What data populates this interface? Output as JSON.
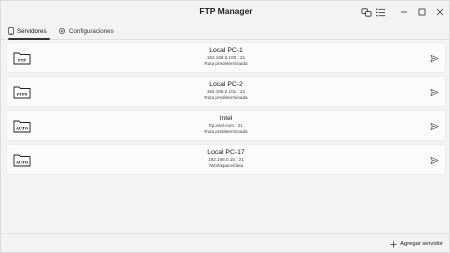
{
  "app": {
    "title": "FTP Manager"
  },
  "window_controls": {
    "minimize": "—",
    "maximize": "☐",
    "close": "✕"
  },
  "tabs": [
    {
      "label": "Servidores",
      "icon": "phone-icon",
      "active": true
    },
    {
      "label": "Configuraciones",
      "icon": "gear-icon",
      "active": false
    }
  ],
  "servers": [
    {
      "name": "Local PC-1",
      "host": "192.168.0.100 : 21",
      "path": "Ruta predeterminada",
      "badge": "FTP"
    },
    {
      "name": "Local PC-2",
      "host": "192.168.0.101 : 21",
      "path": "Ruta predeterminada",
      "badge": "FTPS"
    },
    {
      "name": "Intel",
      "host": "ftp.intel.com : 21",
      "path": "Ruta predeterminada",
      "badge": "AUTO"
    },
    {
      "name": "Local PC-17",
      "host": "192.168.0.15 : 21",
      "path": "/Workspace/data",
      "badge": "AUTO"
    }
  ],
  "footer": {
    "add_server_label": "Agregar servidor",
    "add_icon": "plus-icon"
  }
}
